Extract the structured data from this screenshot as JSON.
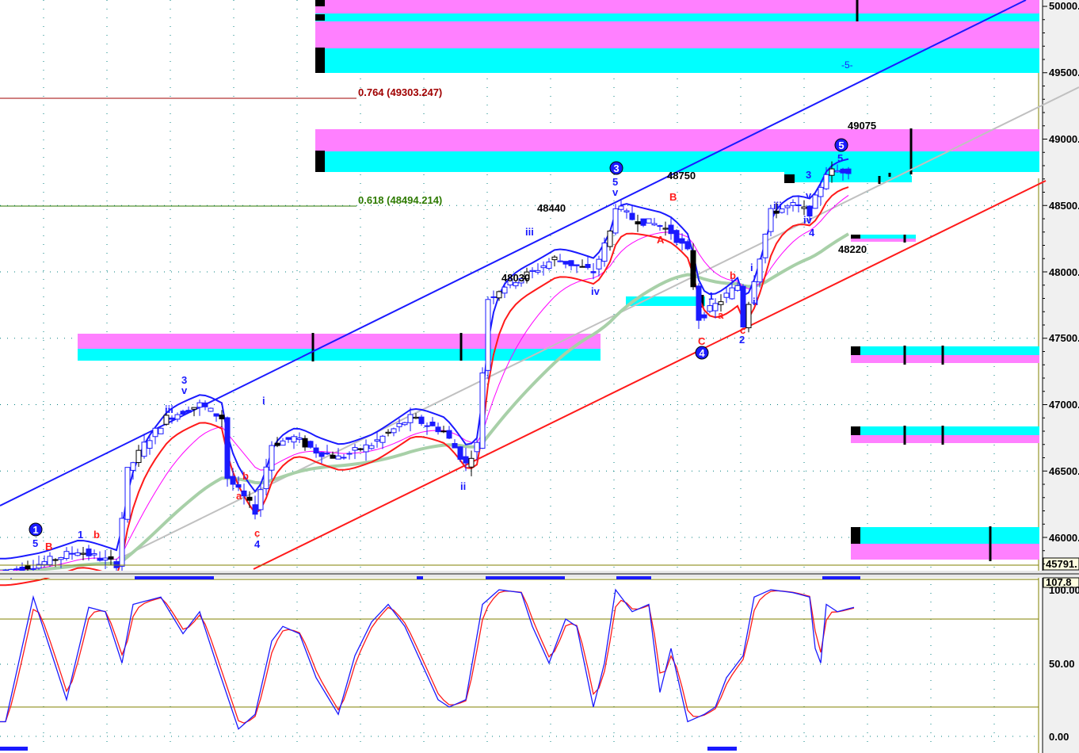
{
  "chart_data": {
    "type": "candlestick-with-indicators",
    "price_axis": {
      "range": [
        45750,
        50050
      ],
      "ticks": [
        "50000.",
        "49500.",
        "49000.",
        "48500.",
        "48000.",
        "47500.",
        "47000.",
        "46500.",
        "46000."
      ],
      "last_marker": "45791."
    },
    "oscillator_axis": {
      "range": [
        -5,
        108
      ],
      "ticks": [
        "100.00",
        "50.00",
        "0.00"
      ],
      "top_marker": "107.8",
      "levels": [
        80,
        20
      ]
    },
    "fib_levels": [
      {
        "label": "0.764 (49303.247)",
        "value": 49303.247,
        "color": "#a00000"
      },
      {
        "label": "0.618 (48494.214)",
        "value": 48494.214,
        "color": "#2d7a00"
      }
    ],
    "price_path": [
      [
        1,
        45750
      ],
      [
        7,
        45800
      ],
      [
        14,
        45900
      ],
      [
        21,
        45800
      ],
      [
        23,
        46500
      ],
      [
        26,
        46700
      ],
      [
        30,
        46900
      ],
      [
        36,
        47000
      ],
      [
        40,
        46900
      ],
      [
        41,
        46450
      ],
      [
        44,
        46300
      ],
      [
        46,
        46200
      ],
      [
        49,
        46700
      ],
      [
        53,
        46750
      ],
      [
        57,
        46650
      ],
      [
        61,
        46600
      ],
      [
        67,
        46700
      ],
      [
        74,
        46900
      ],
      [
        80,
        46800
      ],
      [
        84,
        46550
      ],
      [
        86,
        46700
      ],
      [
        88,
        47800
      ],
      [
        91,
        47900
      ],
      [
        96,
        48000
      ],
      [
        100,
        48100
      ],
      [
        107,
        48000
      ],
      [
        110,
        48300
      ],
      [
        111,
        48500
      ],
      [
        114,
        48400
      ],
      [
        119,
        48350
      ],
      [
        121,
        48300
      ],
      [
        124,
        48150
      ],
      [
        126,
        47650
      ],
      [
        129,
        47750
      ],
      [
        133,
        47900
      ],
      [
        134,
        47600
      ],
      [
        136,
        47950
      ],
      [
        139,
        48450
      ],
      [
        143,
        48500
      ],
      [
        146,
        48450
      ],
      [
        149,
        48750
      ],
      [
        153,
        48770
      ]
    ],
    "oscillator_path": [
      [
        1,
        10
      ],
      [
        6,
        95
      ],
      [
        9,
        60
      ],
      [
        12,
        25
      ],
      [
        16,
        88
      ],
      [
        19,
        85
      ],
      [
        22,
        50
      ],
      [
        24,
        90
      ],
      [
        29,
        95
      ],
      [
        33,
        70
      ],
      [
        36,
        85
      ],
      [
        39,
        50
      ],
      [
        43,
        5
      ],
      [
        46,
        15
      ],
      [
        49,
        65
      ],
      [
        51,
        75
      ],
      [
        54,
        70
      ],
      [
        57,
        40
      ],
      [
        61,
        15
      ],
      [
        64,
        55
      ],
      [
        67,
        78
      ],
      [
        70,
        90
      ],
      [
        73,
        75
      ],
      [
        76,
        50
      ],
      [
        79,
        25
      ],
      [
        81,
        20
      ],
      [
        84,
        25
      ],
      [
        87,
        90
      ],
      [
        90,
        100
      ],
      [
        94,
        98
      ],
      [
        96,
        75
      ],
      [
        99,
        50
      ],
      [
        102,
        80
      ],
      [
        104,
        75
      ],
      [
        107,
        20
      ],
      [
        109,
        50
      ],
      [
        111,
        100
      ],
      [
        114,
        85
      ],
      [
        117,
        90
      ],
      [
        119,
        30
      ],
      [
        121,
        60
      ],
      [
        124,
        10
      ],
      [
        127,
        15
      ],
      [
        129,
        20
      ],
      [
        131,
        40
      ],
      [
        134,
        55
      ],
      [
        136,
        95
      ],
      [
        139,
        100
      ],
      [
        143,
        98
      ],
      [
        146,
        95
      ],
      [
        147,
        60
      ],
      [
        148,
        50
      ],
      [
        149,
        90
      ],
      [
        151,
        85
      ],
      [
        154,
        88
      ]
    ],
    "price_annotations": [
      "48030",
      "48440",
      "48750",
      "49075",
      "48220",
      "-5-"
    ],
    "wave_labels": {
      "circled": [
        "1",
        "3",
        "4",
        "5"
      ],
      "blue": [
        "5",
        "1",
        "3",
        "v",
        "iii",
        "i",
        "c4",
        "4",
        "ii",
        "iii",
        "iv",
        "5",
        "v",
        "iii",
        "i",
        "ii",
        "2",
        "3",
        "v",
        "iv",
        "4",
        "5",
        "1",
        "iii",
        "ii"
      ],
      "red": [
        "B",
        "b",
        "a",
        "b",
        "c",
        "A",
        "B",
        "C",
        "a",
        "b",
        "c"
      ]
    },
    "colors": {
      "zone_magenta": "#ff80ff",
      "zone_cyan": "#00ffff",
      "trend_blue": "#1a1aff",
      "trend_red": "#ff1a1a",
      "trend_grey": "#c0c0c0",
      "ma_green": "#a8d0a8",
      "ma_magenta": "#ff00ff",
      "grid": "#008080",
      "level_olive": "#808000"
    }
  },
  "labels": {
    "fib764": "0.764 (49303.247)",
    "fib618": "0.618 (48494.214)",
    "a48030": "48030",
    "a48440": "48440",
    "a48750": "48750",
    "a49075": "49075",
    "a48220": "48220",
    "a5": "-5-",
    "c1": "1",
    "c3": "3",
    "c4": "4",
    "c5": "5",
    "w5": "5",
    "wB": "B",
    "w1": "1",
    "wb": "b",
    "w3": "3",
    "wv": "v",
    "wiii": "iii",
    "wi": "i",
    "wa": "a",
    "wb2": "b",
    "wc": "c",
    "w4": "4",
    "wii": "ii",
    "wiii2": "iii",
    "wiv": "iv",
    "w5b": "5",
    "wv2": "v",
    "wA": "A",
    "wB2": "B",
    "wC": "C",
    "w1b": "1",
    "wa2": "a",
    "wb3": "b",
    "wc2": "c",
    "w2": "2",
    "wi2": "i",
    "wii2": "ii",
    "wiii3": "iii",
    "w3b": "3",
    "wv3": "v",
    "wiv2": "iv",
    "w4b": "4",
    "w5c": "5",
    "y50000": "50000.",
    "y49500": "49500.",
    "y49000": "49000.",
    "y48500": "48500.",
    "y48000": "48000.",
    "y47500": "47500.",
    "y47000": "47000.",
    "y46500": "46500.",
    "y46000": "46000.",
    "ylast": "45791.",
    "o100": "100.00",
    "o50": "50.00",
    "o0": "0.00",
    "otop": "107.8"
  }
}
